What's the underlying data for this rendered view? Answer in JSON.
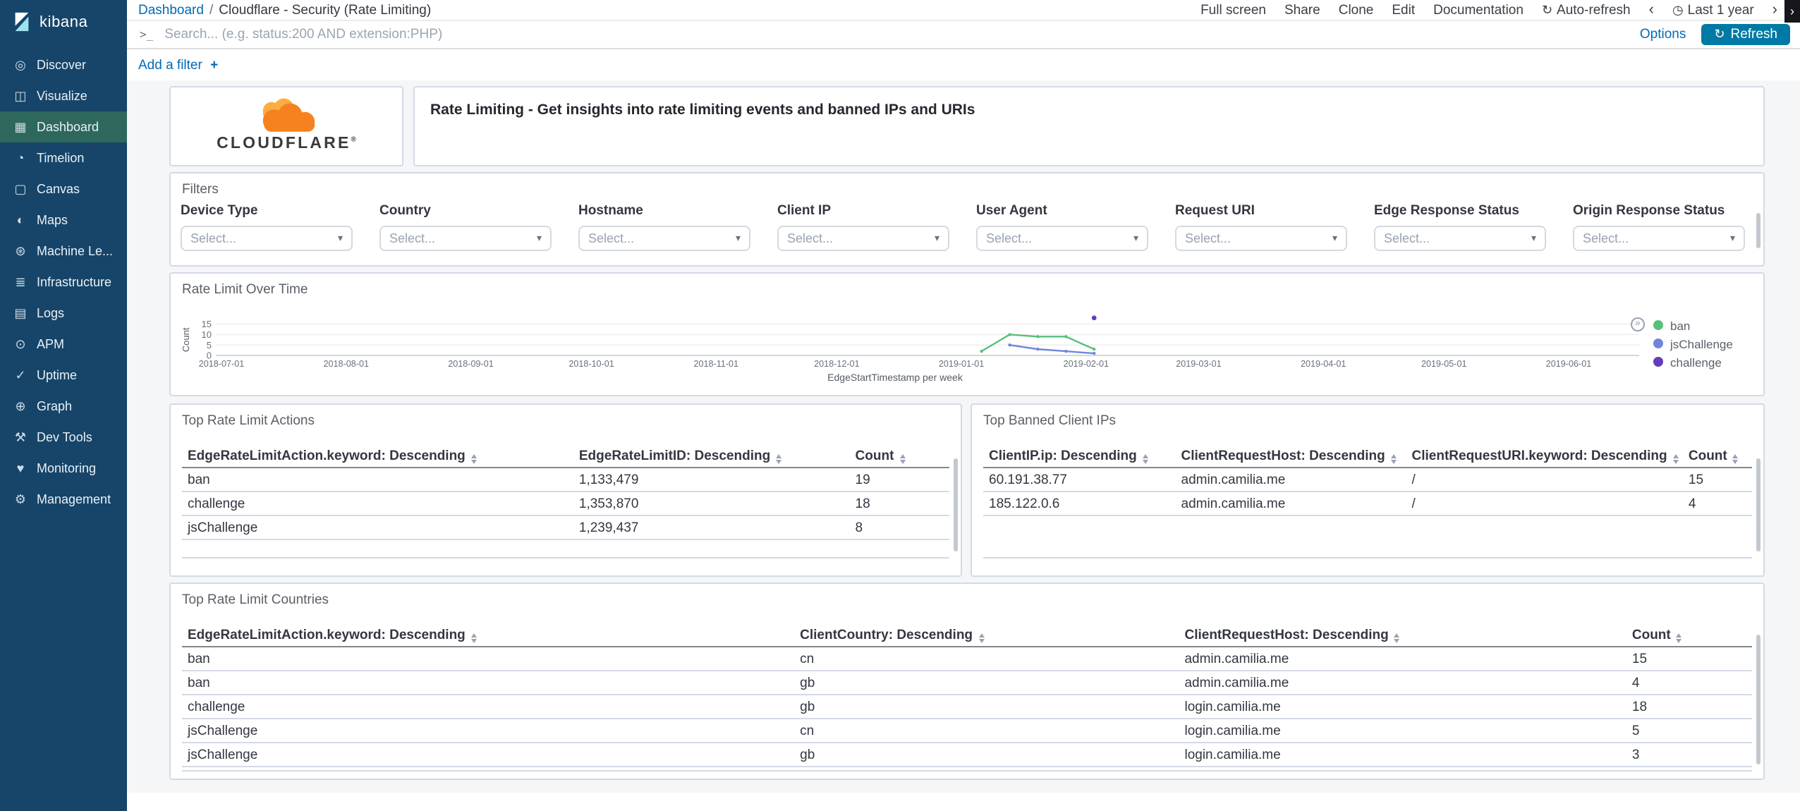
{
  "app": {
    "name": "kibana"
  },
  "colors": {
    "link_blue": "#006BB4",
    "refresh_button": "#0079A5",
    "sidebar_background": "#164569",
    "sidebar_active": "#2E685C",
    "cloudflare_orange": "#F6821F",
    "cloudflare_orange_light": "#FBAD41"
  },
  "sidebar": {
    "items": [
      {
        "label": "Discover",
        "icon": "compass-icon",
        "glyph": "◎",
        "active": false
      },
      {
        "label": "Visualize",
        "icon": "visualize-icon",
        "glyph": "◫",
        "active": false
      },
      {
        "label": "Dashboard",
        "icon": "dashboard-grid-icon",
        "glyph": "▦",
        "active": true
      },
      {
        "label": "Timelion",
        "icon": "timelion-icon",
        "glyph": "◔",
        "active": false
      },
      {
        "label": "Canvas",
        "icon": "canvas-icon",
        "glyph": "▢",
        "active": false
      },
      {
        "label": "Maps",
        "icon": "globe-icon",
        "glyph": "◐",
        "active": false
      },
      {
        "label": "Machine Le...",
        "icon": "machine-learning-icon",
        "glyph": "⊛",
        "active": false
      },
      {
        "label": "Infrastructure",
        "icon": "infrastructure-icon",
        "glyph": "≣",
        "active": false
      },
      {
        "label": "Logs",
        "icon": "logs-icon",
        "glyph": "▤",
        "active": false
      },
      {
        "label": "APM",
        "icon": "apm-icon",
        "glyph": "⊙",
        "active": false
      },
      {
        "label": "Uptime",
        "icon": "uptime-icon",
        "glyph": "✓",
        "active": false
      },
      {
        "label": "Graph",
        "icon": "graph-icon",
        "glyph": "⊕",
        "active": false
      },
      {
        "label": "Dev Tools",
        "icon": "dev-tools-icon",
        "glyph": "⚒",
        "active": false
      },
      {
        "label": "Monitoring",
        "icon": "monitoring-icon",
        "glyph": "♥",
        "active": false
      },
      {
        "label": "Management",
        "icon": "gear-icon",
        "glyph": "⚙",
        "active": false
      }
    ]
  },
  "breadcrumb": {
    "root": "Dashboard",
    "separator": "/",
    "current": "Cloudflare - Security (Rate Limiting)"
  },
  "top_menu": {
    "items": [
      "Full screen",
      "Share",
      "Clone",
      "Edit",
      "Documentation"
    ],
    "auto_refresh": {
      "icon": "auto-refresh-icon",
      "glyph": "↻",
      "label": "Auto-refresh"
    },
    "time_prev_glyph": "‹",
    "time_picker": {
      "icon": "clock-icon",
      "glyph": "◷",
      "label": "Last 1 year"
    },
    "time_next_glyph": "›",
    "edge_glyph": "›"
  },
  "search_bar": {
    "prompt": ">_",
    "value": "",
    "placeholder": "Search... (e.g. status:200 AND extension:PHP)",
    "options_label": "Options",
    "refresh": {
      "glyph": "↻",
      "label": "Refresh"
    }
  },
  "filter_bar": {
    "add_label": "Add a filter",
    "plus_glyph": "+"
  },
  "panels": {
    "logo": {
      "brand": "CLOUDFLARE",
      "registered_mark": "®"
    },
    "description": {
      "text": "Rate Limiting - Get insights into rate limiting events and banned IPs and URIs"
    },
    "filters": {
      "title": "Filters",
      "select_placeholder": "Select...",
      "caret_glyph": "▾",
      "fields": [
        "Device Type",
        "Country",
        "Hostname",
        "Client IP",
        "User Agent",
        "Request URI",
        "Edge Response Status",
        "Origin Response Status"
      ]
    },
    "rate_limit_over_time": {
      "title": "Rate Limit Over Time",
      "legend_toggle_glyph": "»"
    },
    "top_rate_limit_actions": {
      "title": "Top Rate Limit Actions",
      "columns": [
        "EdgeRateLimitAction.keyword: Descending",
        "EdgeRateLimitID: Descending",
        "Count"
      ],
      "rows": [
        [
          "ban",
          "1,133,479",
          "19"
        ],
        [
          "challenge",
          "1,353,870",
          "18"
        ],
        [
          "jsChallenge",
          "1,239,437",
          "8"
        ]
      ]
    },
    "top_banned_client_ips": {
      "title": "Top Banned Client IPs",
      "columns": [
        "ClientIP.ip: Descending",
        "ClientRequestHost: Descending",
        "ClientRequestURI.keyword: Descending",
        "Count"
      ],
      "rows": [
        [
          "60.191.38.77",
          "admin.camilia.me",
          "/",
          "15"
        ],
        [
          "185.122.0.6",
          "admin.camilia.me",
          "/",
          "4"
        ]
      ]
    },
    "top_rate_limit_countries": {
      "title": "Top Rate Limit Countries",
      "columns": [
        "EdgeRateLimitAction.keyword: Descending",
        "ClientCountry: Descending",
        "ClientRequestHost: Descending",
        "Count"
      ],
      "rows": [
        [
          "ban",
          "cn",
          "admin.camilia.me",
          "15"
        ],
        [
          "ban",
          "gb",
          "admin.camilia.me",
          "4"
        ],
        [
          "challenge",
          "gb",
          "login.camilia.me",
          "18"
        ],
        [
          "jsChallenge",
          "cn",
          "login.camilia.me",
          "5"
        ],
        [
          "jsChallenge",
          "gb",
          "login.camilia.me",
          "3"
        ]
      ]
    }
  },
  "chart_data": {
    "type": "line",
    "title": "Rate Limit Over Time",
    "xlabel": "EdgeStartTimestamp per week",
    "ylabel": "Count",
    "ylim": [
      0,
      20
    ],
    "y_ticks": [
      0,
      5,
      10,
      15
    ],
    "x_ticks": [
      "2018-07-01",
      "2018-08-01",
      "2018-09-01",
      "2018-10-01",
      "2018-11-01",
      "2018-12-01",
      "2019-01-01",
      "2019-02-01",
      "2019-03-01",
      "2019-04-01",
      "2019-05-01",
      "2019-06-01"
    ],
    "grid": true,
    "legend_position": "right",
    "series": [
      {
        "name": "ban",
        "color": "#57c17b",
        "points": [
          [
            "2019-01-06",
            2
          ],
          [
            "2019-01-13",
            10
          ],
          [
            "2019-01-20",
            9
          ],
          [
            "2019-01-27",
            9
          ],
          [
            "2019-02-03",
            3
          ]
        ]
      },
      {
        "name": "jsChallenge",
        "color": "#6f87d8",
        "points": [
          [
            "2019-01-13",
            5
          ],
          [
            "2019-01-20",
            3
          ],
          [
            "2019-01-27",
            2
          ],
          [
            "2019-02-03",
            1
          ]
        ]
      },
      {
        "name": "challenge",
        "color": "#663db8",
        "points": [
          [
            "2019-02-03",
            18
          ]
        ]
      }
    ]
  }
}
